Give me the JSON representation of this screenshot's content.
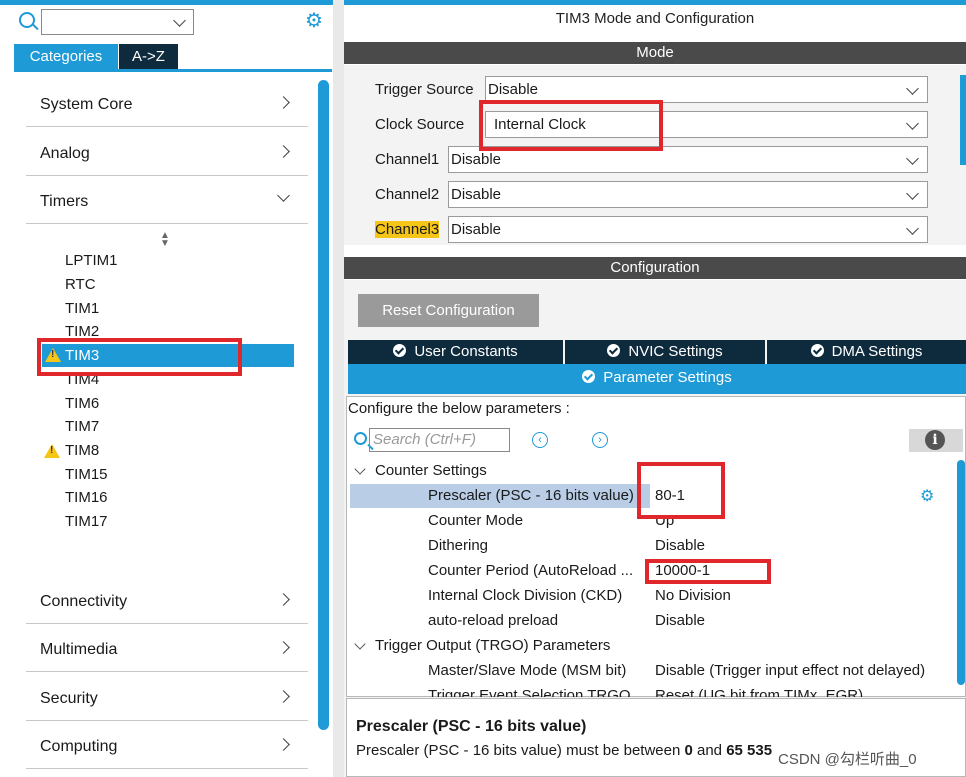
{
  "left": {
    "search": {
      "value": ""
    },
    "tabs": [
      "Categories",
      "A->Z"
    ],
    "categories_top": [
      "System Core",
      "Analog",
      "Timers"
    ],
    "timers": [
      "LPTIM1",
      "RTC",
      "TIM1",
      "TIM2",
      "TIM3",
      "TIM4",
      "TIM6",
      "TIM7",
      "TIM8",
      "TIM15",
      "TIM16",
      "TIM17"
    ],
    "categories_bottom": [
      "Connectivity",
      "Multimedia",
      "Security",
      "Computing"
    ]
  },
  "right": {
    "title": "TIM3 Mode and Configuration",
    "mode_header": "Mode",
    "mode_fields": [
      {
        "label": "Trigger Source",
        "value": "Disable"
      },
      {
        "label": "Clock Source",
        "value": "Internal Clock"
      },
      {
        "label": "Channel1",
        "value": "Disable"
      },
      {
        "label": "Channel2",
        "value": "Disable"
      },
      {
        "label": "Channel3",
        "value": "Disable"
      }
    ],
    "config_header": "Configuration",
    "reset_button": "Reset Configuration",
    "tabs": [
      "User Constants",
      "NVIC Settings",
      "DMA Settings"
    ],
    "active_tab": "Parameter Settings",
    "configure_text": "Configure the below parameters :",
    "search_placeholder": "Search (Ctrl+F)",
    "groups": [
      {
        "name": "Counter Settings",
        "params": [
          {
            "label": "Prescaler (PSC - 16 bits value)",
            "value": "80-1"
          },
          {
            "label": "Counter Mode",
            "value": "Up"
          },
          {
            "label": "Dithering",
            "value": "Disable"
          },
          {
            "label": "Counter Period (AutoReload ...",
            "value": "10000-1"
          },
          {
            "label": "Internal Clock Division (CKD)",
            "value": "No Division"
          },
          {
            "label": "auto-reload preload",
            "value": "Disable"
          }
        ]
      },
      {
        "name": "Trigger Output (TRGO) Parameters",
        "params": [
          {
            "label": "Master/Slave Mode (MSM bit)",
            "value": "Disable (Trigger input effect not delayed)"
          },
          {
            "label": "Trigger Event Selection TRGO",
            "value": "Reset (UG bit from TIMx_EGR)"
          }
        ]
      }
    ],
    "description": {
      "title": "Prescaler (PSC - 16 bits value)",
      "text_pre": "Prescaler (PSC - 16 bits value) must be between ",
      "min": "0",
      "mid": " and ",
      "max": "65 535"
    }
  },
  "watermark": "CSDN @勾栏听曲_0",
  "colors": {
    "accent": "#1e9ad6",
    "dark": "#0e2a3d",
    "highlight_red": "#e0272b",
    "warning": "#f5c518"
  }
}
